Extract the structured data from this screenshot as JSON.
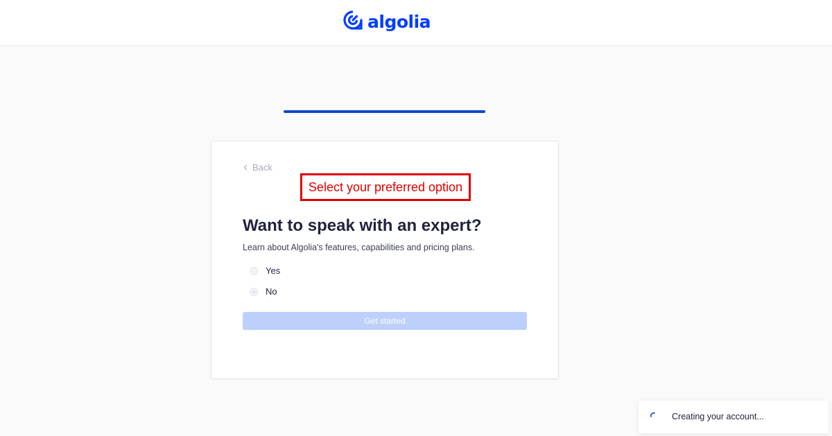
{
  "header": {
    "logo_text": "algolia",
    "brand_color": "#003dff"
  },
  "progress": {
    "fraction": 1.0
  },
  "form": {
    "back_label": "Back",
    "annotation_label": "Select your preferred option",
    "title": "Want to speak with an expert?",
    "description": "Learn about Algolia's features, capabilities and pricing plans.",
    "options": [
      {
        "label": "Yes"
      },
      {
        "label": "No"
      }
    ],
    "submit_label": "Get started"
  },
  "toast": {
    "message": "Creating your account..."
  },
  "icons": {
    "logo": "algolia-logo-icon",
    "back": "chevron-left-icon",
    "toast": "spinner-icon"
  }
}
